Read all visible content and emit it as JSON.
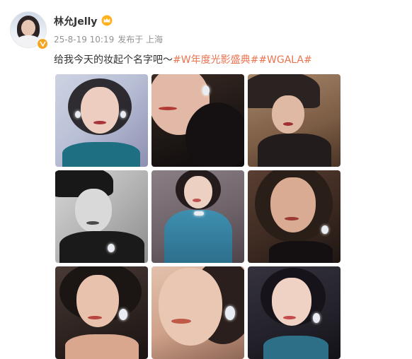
{
  "user": {
    "name": "林允Jelly",
    "badge_icon": "crown-icon",
    "verified_icon": "verified-v-icon"
  },
  "meta": {
    "date": "25-8-19 10:19",
    "source": "发布于 上海"
  },
  "post": {
    "text": "给我今天的妆起个名字吧～",
    "hashtags": [
      "#W年度光影盛典#",
      "#WGALA#"
    ]
  },
  "colors": {
    "hashtag": "#eb7350",
    "verified": "#f4a623",
    "meta": "#939393"
  },
  "photos": [
    {
      "name": "photo-1"
    },
    {
      "name": "photo-2"
    },
    {
      "name": "photo-3"
    },
    {
      "name": "photo-4"
    },
    {
      "name": "photo-5"
    },
    {
      "name": "photo-6"
    },
    {
      "name": "photo-7"
    },
    {
      "name": "photo-8"
    },
    {
      "name": "photo-9"
    }
  ]
}
